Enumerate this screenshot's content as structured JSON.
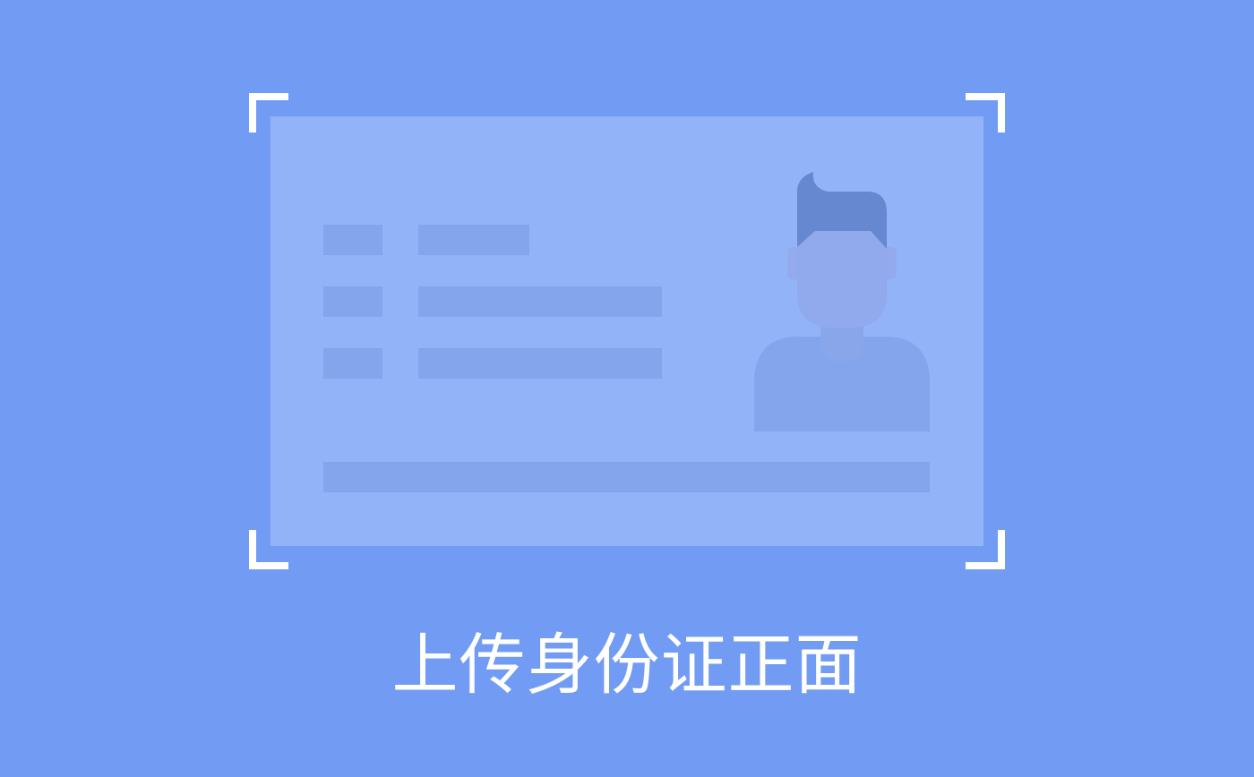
{
  "upload": {
    "caption": "上传身份证正面"
  },
  "colors": {
    "background": "#729cf3",
    "card": "#92b3f8",
    "placeholder_bar": "#84a4eb",
    "hair": "#6688d1",
    "face": "#90aaed",
    "corner_marks": "#ffffff",
    "caption_text": "#ffffff"
  },
  "icons": {
    "avatar": "person-silhouette-icon",
    "frame": "scan-corner-icon"
  }
}
